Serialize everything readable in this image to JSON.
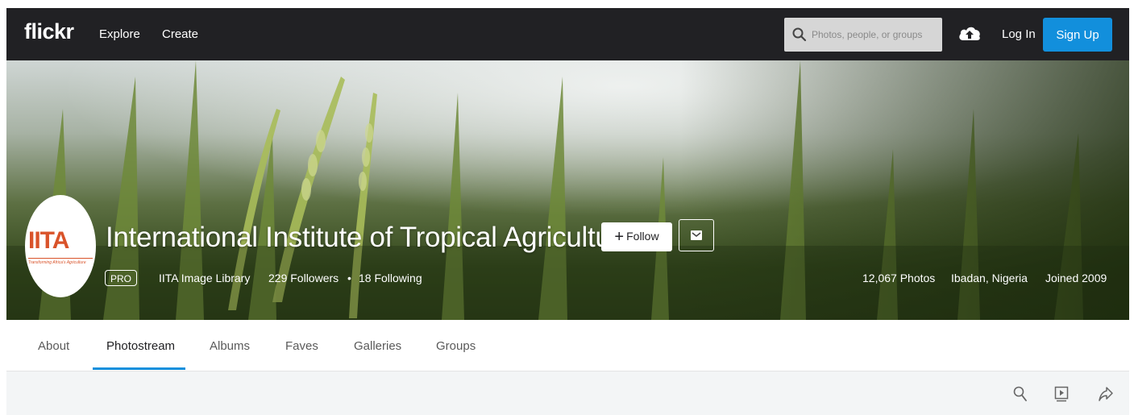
{
  "nav": {
    "logo": "flickr",
    "explore": "Explore",
    "create": "Create",
    "search_placeholder": "Photos, people, or groups",
    "login": "Log In",
    "signup": "Sign Up",
    "icons": {
      "search": "search-icon",
      "upload": "cloud-upload-icon"
    }
  },
  "profile": {
    "avatar_text": "IITA",
    "avatar_subtext": "Transforming Africa's Agriculture",
    "name": "International Institute of Tropical Agriculture",
    "follow_label": "Follow",
    "pro_badge": "PRO",
    "library": "IITA Image Library",
    "followers": "229 Followers",
    "dot": "•",
    "following": "18 Following",
    "photos": "12,067 Photos",
    "location": "Ibadan, Nigeria",
    "joined": "Joined 2009"
  },
  "tabs": [
    {
      "label": "About",
      "active": false
    },
    {
      "label": "Photostream",
      "active": true
    },
    {
      "label": "Albums",
      "active": false
    },
    {
      "label": "Faves",
      "active": false
    },
    {
      "label": "Galleries",
      "active": false
    },
    {
      "label": "Groups",
      "active": false
    }
  ],
  "toolbar": {
    "icons": [
      "search-icon",
      "slideshow-icon",
      "share-icon"
    ]
  },
  "colors": {
    "nav_bg": "#212124",
    "accent": "#128fdc",
    "toolbar_bg": "#f3f5f6",
    "avatar_brand": "#d9532a"
  }
}
